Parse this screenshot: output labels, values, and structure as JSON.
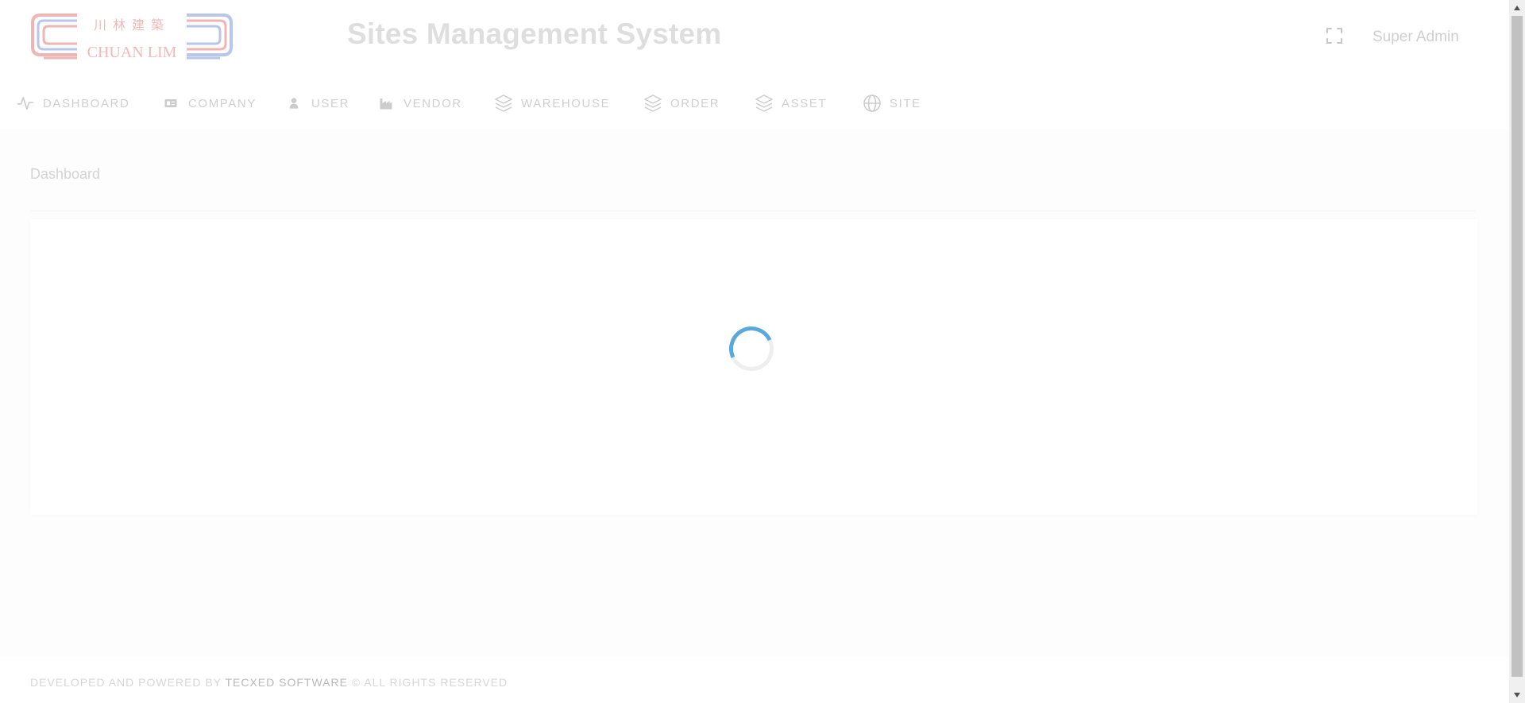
{
  "header": {
    "logo_text": "CHUAN LIM",
    "logo_chinese": "川 林 建 築",
    "title": "Sites Management System",
    "fullscreen_icon": "expand-icon",
    "user_name": "Super Admin"
  },
  "nav": {
    "items": [
      {
        "label": "DASHBOARD",
        "icon": "activity-icon"
      },
      {
        "label": "COMPANY",
        "icon": "id-card-icon"
      },
      {
        "label": "USER",
        "icon": "user-icon"
      },
      {
        "label": "VENDOR",
        "icon": "factory-icon"
      },
      {
        "label": "WAREHOUSE",
        "icon": "layers-icon"
      },
      {
        "label": "ORDER",
        "icon": "layers-icon"
      },
      {
        "label": "ASSET",
        "icon": "layers-icon"
      },
      {
        "label": "SITE",
        "icon": "globe-icon"
      }
    ]
  },
  "breadcrumb": "Dashboard",
  "content": {
    "loading": true,
    "spinner_color": "#5aa9dd"
  },
  "footer": {
    "prefix": "DEVELOPED AND POWERED BY",
    "brand": "TECXED SOFTWARE",
    "suffix": "© ALL RIGHTS RESERVED"
  },
  "colors": {
    "background": "#fdfdfd",
    "text_faded": "#cfcfcf",
    "logo_red": "#f1b4b4",
    "logo_blue": "#b9c6ec"
  }
}
